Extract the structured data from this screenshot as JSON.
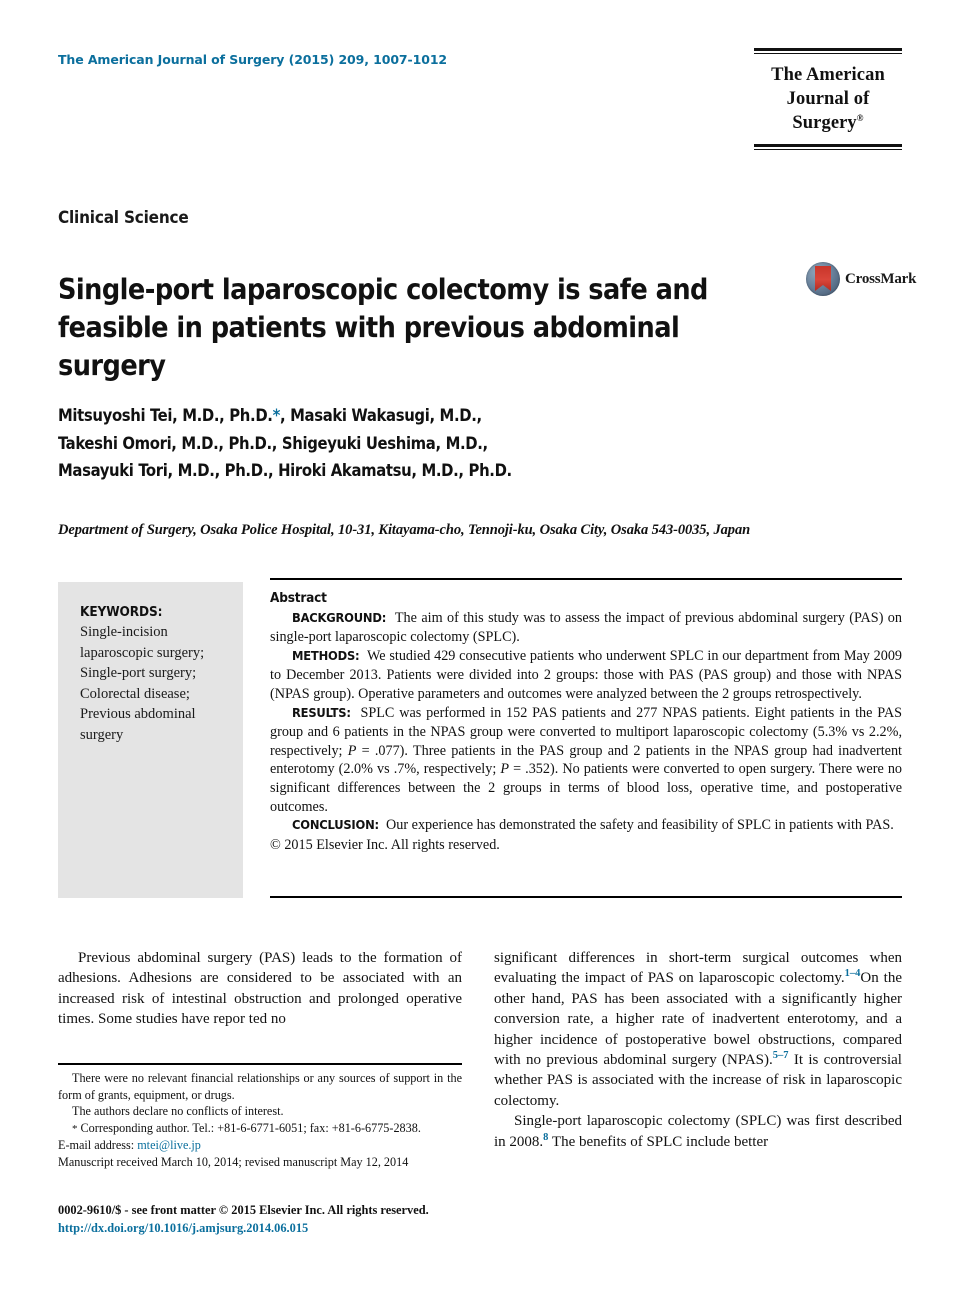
{
  "masthead": {
    "journal_citation": "The American Journal of Surgery (2015) 209, 1007-1012",
    "logo_line1": "The American",
    "logo_line2": "Journal of Surgery"
  },
  "article": {
    "kicker": "Clinical Science",
    "title": "Single-port laparoscopic colectomy is safe and feasible in patients with previous abdominal surgery",
    "crossmark_label": "CrossMark",
    "authors_line1_a": "Mitsuyoshi Tei, M.D., Ph.D.",
    "authors_star": "*",
    "authors_line1_b": ", Masaki Wakasugi, M.D.,",
    "authors_line2": "Takeshi Omori, M.D., Ph.D., Shigeyuki Ueshima, M.D.,",
    "authors_line3": "Masayuki Tori, M.D., Ph.D., Hiroki Akamatsu, M.D., Ph.D.",
    "affiliation": "Department of Surgery, Osaka Police Hospital, 10-31, Kitayama-cho, Tennoji-ku, Osaka City, Osaka 543-0035, Japan"
  },
  "keywords": {
    "heading": "KEYWORDS:",
    "list": "Single-incision laparoscopic surgery; Single-port surgery; Colorectal disease; Previous abdominal surgery"
  },
  "abstract": {
    "heading": "Abstract",
    "background_label": "BACKGROUND:",
    "background_text": "The aim of this study was to assess the impact of previous abdominal surgery (PAS) on single-port laparoscopic colectomy (SPLC).",
    "methods_label": "METHODS:",
    "methods_text": "We studied 429 consecutive patients who underwent SPLC in our department from May 2009 to December 2013. Patients were divided into 2 groups: those with PAS (PAS group) and those with NPAS (NPAS group). Operative parameters and outcomes were analyzed between the 2 groups retrospectively.",
    "results_label": "RESULTS:",
    "results_text_1": "SPLC was performed in 152 PAS patients and 277 NPAS patients. Eight patients in the PAS group and 6 patients in the NPAS group were converted to multiport laparoscopic colectomy (5.3% vs 2.2%, respectively; ",
    "results_p1": "P",
    "results_text_2": " = .077). Three patients in the PAS group and 2 patients in the NPAS group had inadvertent enterotomy (2.0% vs .7%, respectively; ",
    "results_p2": "P",
    "results_text_3": " = .352). No patients were converted to open surgery. There were no significant differences between the 2 groups in terms of blood loss, operative time, and postoperative outcomes.",
    "conclusion_label": "CONCLUSION:",
    "conclusion_text": "Our experience has demonstrated the safety and feasibility of SPLC in patients with PAS.",
    "copyright": "© 2015 Elsevier Inc. All rights reserved."
  },
  "body": {
    "left_para_1": "Previous abdominal surgery (PAS) leads to the formation of adhesions. Adhesions are considered to be associated with an increased risk of intestinal obstruction and prolonged operative times. Some studies have repor ted no",
    "right_para_1_a": "significant differences in short-term surgical outcomes when evaluating the impact of PAS on laparoscopic colectomy.",
    "right_ref_1": "1–4",
    "right_para_1_b": "On the other hand, PAS has been associated with a significantly higher conversion rate, a higher rate of inadvertent enterotomy, and a higher incidence of postoperative bowel obstructions, compared with no previous abdominal surgery (NPAS).",
    "right_ref_2": "5–7",
    "right_para_1_c": " It is controversial whether PAS is associated with the increase of risk in laparoscopic colectomy.",
    "right_para_2_a": "Single-port laparoscopic colectomy (SPLC) was first described in 2008.",
    "right_ref_3": "8",
    "right_para_2_b": " The benefits of SPLC include better"
  },
  "footnotes": {
    "line_1": "There were no relevant financial relationships or any sources of support in the form of grants, equipment, or drugs.",
    "line_2": "The authors declare no conflicts of interest.",
    "star": "*",
    "line_3": " Corresponding author. Tel.: +81-6-6771-6051; fax: +81-6-6775-2838.",
    "email_label": "E-mail address: ",
    "email": "mtei@live.jp",
    "line_4": "Manuscript received March 10, 2014; revised manuscript May 12, 2014"
  },
  "page_footer": {
    "issn_line": "0002-9610/$ - see front matter © 2015 Elsevier Inc. All rights reserved.",
    "doi": "http://dx.doi.org/10.1016/j.amjsurg.2014.06.015"
  },
  "colors": {
    "accent_blue": "#0b6f9d",
    "keyword_box_bg": "#e4e4e4",
    "crossmark_red": "#c8352a"
  }
}
